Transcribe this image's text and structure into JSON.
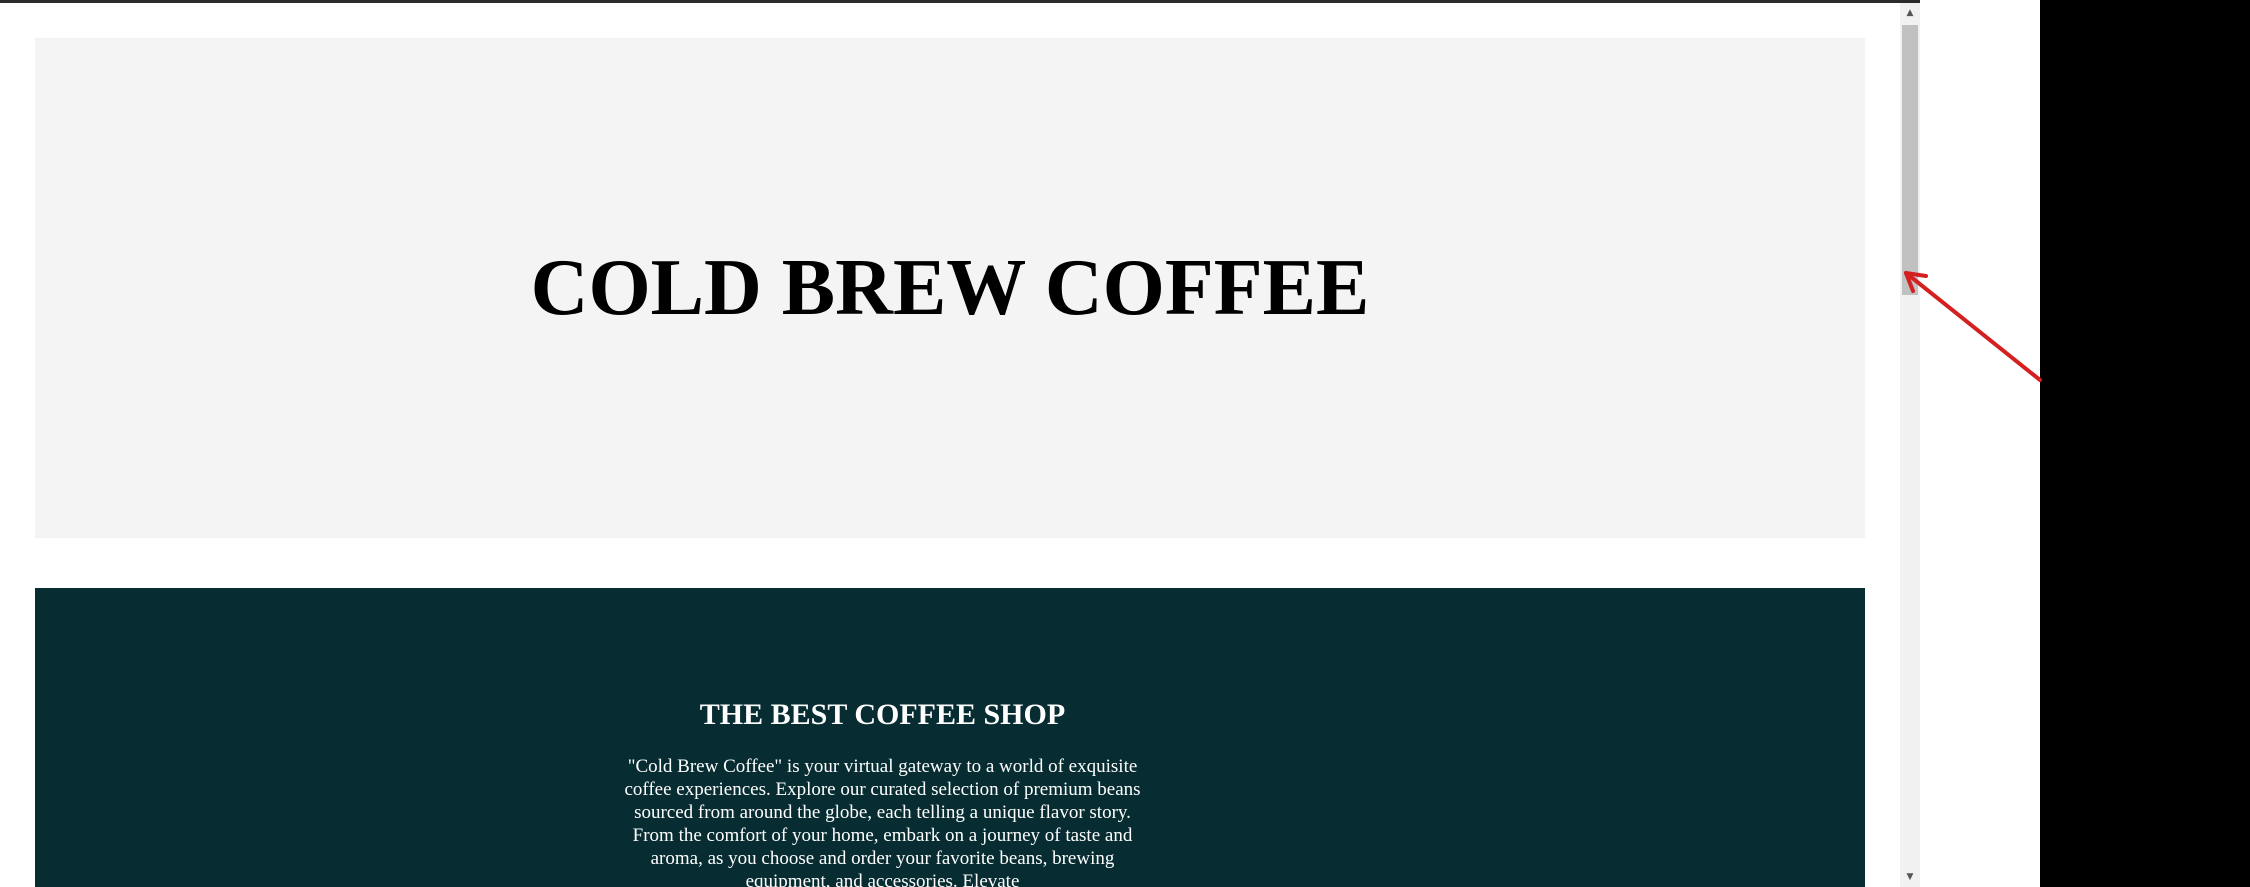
{
  "hero": {
    "title": "COLD BREW COFFEE"
  },
  "about": {
    "heading": "THE BEST COFFEE SHOP",
    "text": "\"Cold Brew Coffee\" is your virtual gateway to a world of exquisite coffee experiences. Explore our curated selection of premium beans sourced from around the globe, each telling a unique flavor story. From the comfort of your home, embark on a journey of taste and aroma, as you choose and order your favorite beans, brewing equipment, and accessories. Elevate"
  },
  "scrollbar": {
    "up_icon": "scroll-up-arrow-icon",
    "down_icon": "scroll-down-arrow-icon",
    "position_fraction": 0.0
  },
  "colors": {
    "hero_bg": "#f4f4f4",
    "about_bg": "#072d32",
    "annotation_arrow": "#d42020"
  }
}
